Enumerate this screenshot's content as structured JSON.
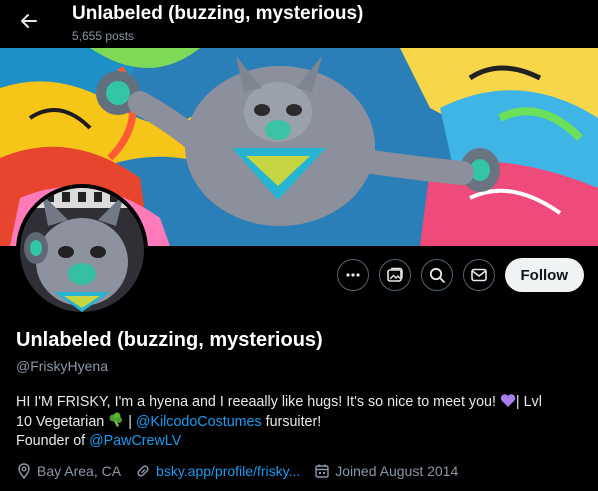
{
  "header": {
    "title": "Unlabeled (buzzing, mysterious)",
    "posts": "5,655 posts"
  },
  "actions": {
    "follow_label": "Follow",
    "icons": [
      "more-icon",
      "media-icon",
      "search-icon",
      "message-icon"
    ]
  },
  "profile": {
    "display_name": "Unlabeled (buzzing, mysterious)",
    "handle": "@FriskyHyena",
    "bio": {
      "line1_text": "HI I'M FRISKY, I'm a hyena and I reeaally like hugs! It's so nice to meet you! ",
      "line1_after": "| Lvl",
      "line2_start": "10 Vegetarian ",
      "line2_sep": " | ",
      "line2_mention": "@KilcodoCostumes",
      "line2_end": " fursuiter!",
      "line3_start": "Founder of ",
      "line3_mention": "@PawCrewLV"
    },
    "location": "Bay Area, CA",
    "website": "bsky.app/profile/frisky...",
    "joined": "Joined August 2014"
  },
  "colors": {
    "background": "#000000",
    "text": "#e7e9ea",
    "muted": "#8b98a5",
    "link": "#1d9bf0",
    "follow_bg": "#eff3f4",
    "heart": "#a77de8",
    "broccoli": "#4e9a2f"
  }
}
